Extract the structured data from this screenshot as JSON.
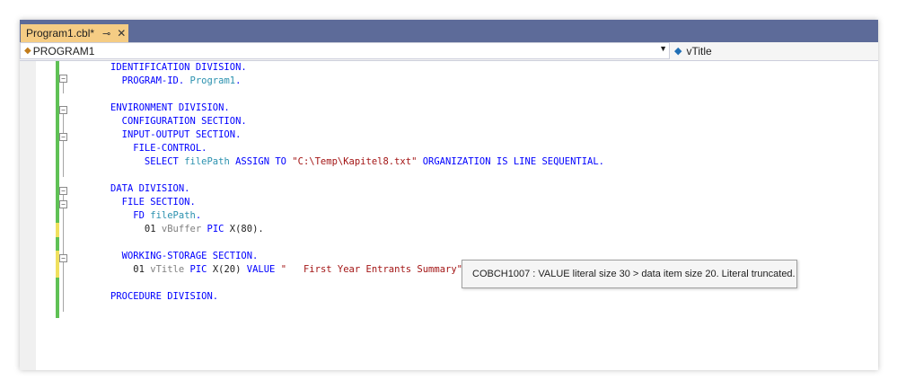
{
  "tab": {
    "title": "Program1.cbl*",
    "pin_glyph": "⊸",
    "close_glyph": "✕"
  },
  "navbar": {
    "left_label": "PROGRAM1",
    "right_label": "vTitle"
  },
  "code": {
    "l1": {
      "a": "IDENTIFICATION DIVISION."
    },
    "l2": {
      "a": "  PROGRAM-ID.",
      "b": " Program1",
      "c": "."
    },
    "l4": {
      "a": "ENVIRONMENT DIVISION."
    },
    "l5": {
      "a": "  CONFIGURATION SECTION."
    },
    "l6": {
      "a": "  INPUT-OUTPUT SECTION."
    },
    "l7": {
      "a": "    FILE-CONTROL."
    },
    "l8": {
      "a": "      SELECT ",
      "b": "filePath",
      "c": " ASSIGN TO ",
      "d": "\"C:\\Temp\\Kapitel8.txt\"",
      "e": " ORGANIZATION IS LINE SEQUENTIAL."
    },
    "l10": {
      "a": "DATA DIVISION."
    },
    "l11": {
      "a": "  FILE SECTION."
    },
    "l12": {
      "a": "    FD ",
      "b": "filePath",
      "c": "."
    },
    "l13": {
      "a": "      01 ",
      "b": "vBuffer",
      "c": " PIC ",
      "d": "X(80)."
    },
    "l15": {
      "a": "  WORKING-STORAGE SECTION."
    },
    "l16": {
      "a": "    01 ",
      "b": "vTitle",
      "c": " PIC ",
      "d": "X(20) ",
      "e": "VALUE ",
      "f": "\"   First Year Entrants Summary\""
    },
    "l18": {
      "a": "PROCEDURE DIVISION."
    }
  },
  "tooltip": {
    "text": "COBCH1007 : VALUE literal size 30 > data item size 20. Literal truncated."
  },
  "colors": {
    "accent_tab": "#f5cc84",
    "keyword": "#0000ff",
    "identifier": "#2b91af",
    "string": "#a31515",
    "change_saved": "#5fc155",
    "change_unsaved": "#f0e05e",
    "frame": "#5d6b99"
  }
}
